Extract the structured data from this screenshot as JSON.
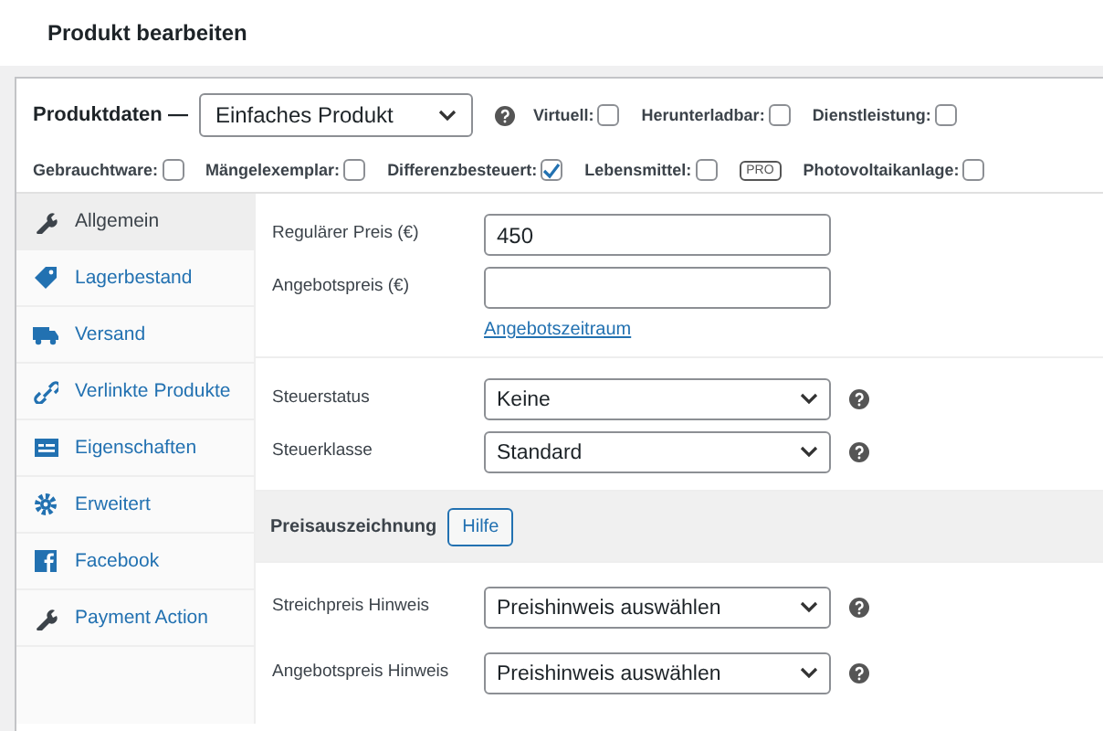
{
  "page_title": "Produkt bearbeiten",
  "product_data": {
    "label": "Produktdaten —",
    "type_select": "Einfaches Produkt",
    "options": [
      {
        "label": "Virtuell:",
        "checked": false,
        "kind": "checkbox"
      },
      {
        "label": "Herunterladbar:",
        "checked": false,
        "kind": "checkbox"
      },
      {
        "label": "Dienstleistung:",
        "checked": false,
        "kind": "checkbox"
      },
      {
        "label": "Gebrauchtware:",
        "checked": false,
        "kind": "checkbox"
      },
      {
        "label": "Mängelexemplar:",
        "checked": false,
        "kind": "checkbox"
      },
      {
        "label": "Differenzbesteuert:",
        "checked": true,
        "kind": "checkbox"
      },
      {
        "label": "Lebensmittel:",
        "checked": false,
        "kind": "checkbox"
      },
      {
        "label": "PRO",
        "kind": "badge"
      },
      {
        "label": "Photovoltaikanlage:",
        "checked": false,
        "kind": "checkbox"
      }
    ]
  },
  "tabs": [
    {
      "label": "Allgemein",
      "selected": true
    },
    {
      "label": "Lagerbestand",
      "selected": false
    },
    {
      "label": "Versand",
      "selected": false
    },
    {
      "label": "Verlinkte Produkte",
      "selected": false
    },
    {
      "label": "Eigenschaften",
      "selected": false
    },
    {
      "label": "Erweitert",
      "selected": false
    },
    {
      "label": "Facebook",
      "selected": false
    },
    {
      "label": "Payment Action",
      "selected": false
    }
  ],
  "sections": [
    {
      "kind": "fields",
      "fields": [
        {
          "kind": "input",
          "label": "Regulärer Preis (€)",
          "value": "450"
        },
        {
          "kind": "input",
          "label": "Angebotspreis (€)",
          "link": "Angebotszeitraum"
        }
      ]
    },
    {
      "kind": "fields",
      "fields": [
        {
          "kind": "select",
          "label": "Steuerstatus",
          "value": "Keine"
        },
        {
          "kind": "select",
          "label": "Steuerklasse",
          "value": "Standard"
        }
      ]
    },
    {
      "kind": "heading",
      "title": "Preisauszeichnung",
      "button": "Hilfe"
    },
    {
      "kind": "fields",
      "fields": [
        {
          "kind": "select",
          "label": "Streichpreis Hinweis",
          "value": "Preishinweis auswählen"
        },
        {
          "kind": "select",
          "label": "Angebotspreis Hinweis",
          "value": "Preishinweis auswählen"
        }
      ]
    }
  ]
}
